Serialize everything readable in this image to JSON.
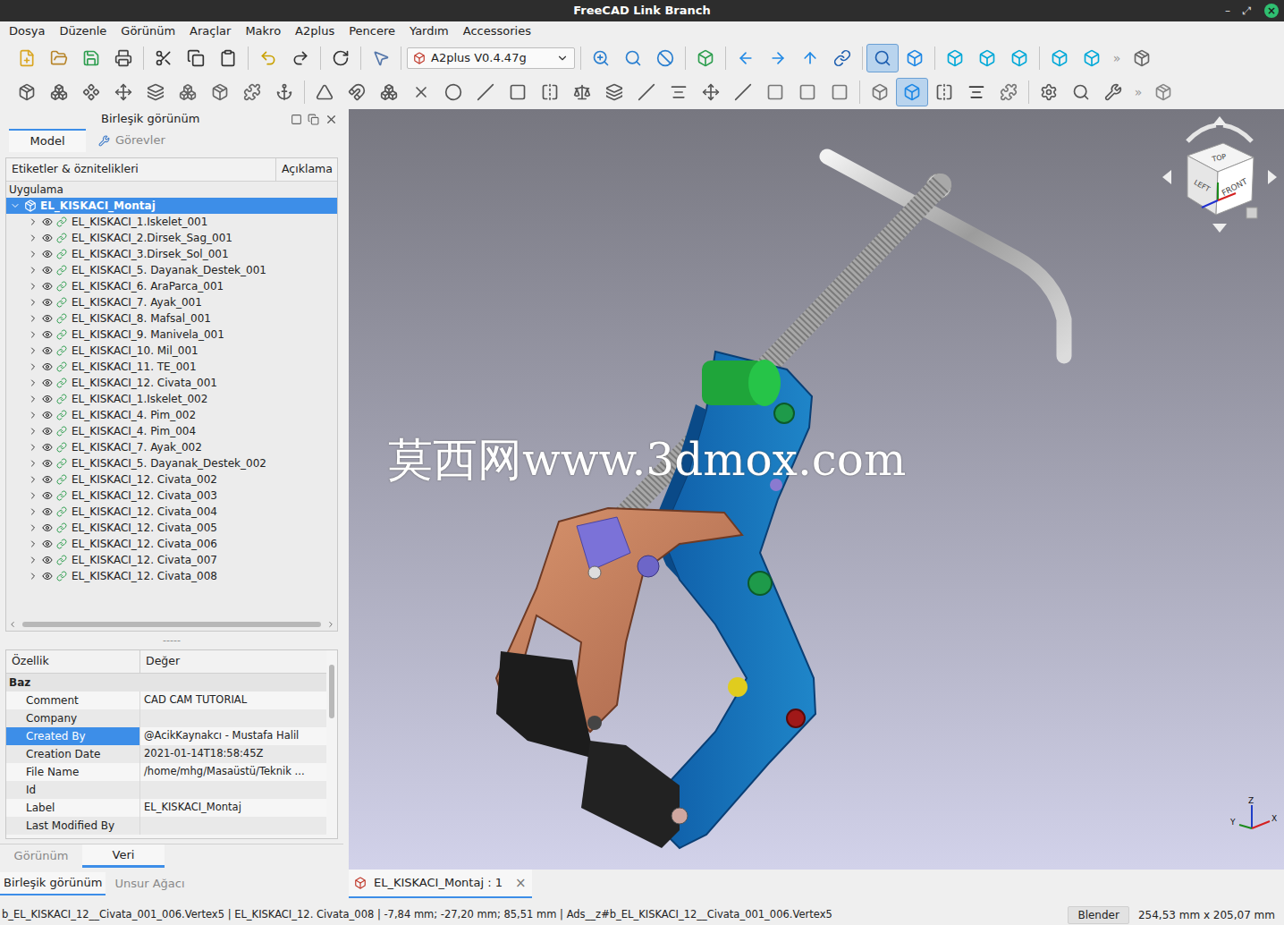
{
  "window": {
    "title": "FreeCAD Link Branch",
    "controls": [
      "–",
      "⤢",
      "×"
    ]
  },
  "menu": [
    "Dosya",
    "Düzenle",
    "Görünüm",
    "Araçlar",
    "Makro",
    "A2plus",
    "Pencere",
    "Yardım",
    "Accessories"
  ],
  "toolbars": {
    "workbench": "A2plus V0.4.47g",
    "overflow": "»",
    "row1": [
      false,
      false,
      false,
      false,
      false,
      false,
      false,
      false,
      false,
      false,
      false,
      false,
      false,
      false,
      false,
      false,
      false,
      false,
      false,
      true,
      false,
      false,
      false,
      false,
      false,
      false,
      false
    ],
    "row2": [
      false,
      false,
      false,
      false,
      false,
      false,
      false,
      false,
      false,
      false,
      false,
      false,
      false,
      false,
      false,
      false,
      false,
      false,
      false,
      false,
      false,
      false,
      false,
      false,
      false,
      false,
      false,
      true,
      false,
      false,
      false,
      false,
      false,
      false,
      false
    ]
  },
  "combo_view": {
    "title": "Birleşik görünüm",
    "tabs": [
      {
        "label": "Model",
        "selected": true
      },
      {
        "label": "Görevler",
        "selected": false
      }
    ]
  },
  "tree": {
    "columns": [
      "Etiketler & öznitelikleri",
      "Açıklama"
    ],
    "group": "Uygulama",
    "root": {
      "label": "EL_KISKACI_Montaj",
      "selected": true,
      "expanded": true
    },
    "items": [
      {
        "label": "EL_KISKACI_1.Iskelet_001",
        "selected": false,
        "expanded": false,
        "visible": true
      },
      {
        "label": "EL_KISKACI_2.Dirsek_Sag_001",
        "selected": false,
        "expanded": false,
        "visible": true
      },
      {
        "label": "EL_KISKACI_3.Dirsek_Sol_001",
        "selected": false,
        "expanded": false,
        "visible": true
      },
      {
        "label": "EL_KISKACI_5. Dayanak_Destek_001",
        "selected": false,
        "expanded": false,
        "visible": true
      },
      {
        "label": "EL_KISKACI_6. AraParca_001",
        "selected": false,
        "expanded": false,
        "visible": true
      },
      {
        "label": "EL_KISKACI_7. Ayak_001",
        "selected": false,
        "expanded": false,
        "visible": true
      },
      {
        "label": "EL_KISKACI_8. Mafsal_001",
        "selected": false,
        "expanded": false,
        "visible": true
      },
      {
        "label": "EL_KISKACI_9. Manivela_001",
        "selected": false,
        "expanded": false,
        "visible": true
      },
      {
        "label": "EL_KISKACI_10. Mil_001",
        "selected": false,
        "expanded": false,
        "visible": true
      },
      {
        "label": "EL_KISKACI_11. TE_001",
        "selected": false,
        "expanded": false,
        "visible": true
      },
      {
        "label": "EL_KISKACI_12. Civata_001",
        "selected": false,
        "expanded": false,
        "visible": true
      },
      {
        "label": "EL_KISKACI_1.Iskelet_002",
        "selected": false,
        "expanded": false,
        "visible": true
      },
      {
        "label": "EL_KISKACI_4. Pim_002",
        "selected": false,
        "expanded": false,
        "visible": true
      },
      {
        "label": "EL_KISKACI_4. Pim_004",
        "selected": false,
        "expanded": false,
        "visible": true
      },
      {
        "label": "EL_KISKACI_7. Ayak_002",
        "selected": false,
        "expanded": false,
        "visible": true
      },
      {
        "label": "EL_KISKACI_5. Dayanak_Destek_002",
        "selected": false,
        "expanded": false,
        "visible": true
      },
      {
        "label": "EL_KISKACI_12. Civata_002",
        "selected": false,
        "expanded": false,
        "visible": true
      },
      {
        "label": "EL_KISKACI_12. Civata_003",
        "selected": false,
        "expanded": false,
        "visible": true
      },
      {
        "label": "EL_KISKACI_12. Civata_004",
        "selected": false,
        "expanded": false,
        "visible": true
      },
      {
        "label": "EL_KISKACI_12. Civata_005",
        "selected": false,
        "expanded": false,
        "visible": true
      },
      {
        "label": "EL_KISKACI_12. Civata_006",
        "selected": false,
        "expanded": false,
        "visible": true
      },
      {
        "label": "EL_KISKACI_12. Civata_007",
        "selected": false,
        "expanded": false,
        "visible": true
      },
      {
        "label": "EL_KISKACI_12. Civata_008",
        "selected": false,
        "expanded": false,
        "visible": true
      }
    ]
  },
  "splitter": "-----",
  "properties": {
    "columns": [
      "Özellik",
      "Değer"
    ],
    "group": "Baz",
    "rows": [
      {
        "name": "Comment",
        "value": "CAD CAM TUTORIAL",
        "selected": false
      },
      {
        "name": "Company",
        "value": "",
        "selected": false
      },
      {
        "name": "Created By",
        "value": "@AcikKaynakcı - Mustafa Halil",
        "selected": true
      },
      {
        "name": "Creation Date",
        "value": "2021-01-14T18:58:45Z",
        "selected": false
      },
      {
        "name": "File Name",
        "value": "/home/mhg/Masaüstü/Teknik ...",
        "selected": false
      },
      {
        "name": "Id",
        "value": "",
        "selected": false
      },
      {
        "name": "Label",
        "value": "EL_KISKACI_Montaj",
        "selected": false
      },
      {
        "name": "Last Modified By",
        "value": "",
        "selected": false
      }
    ]
  },
  "property_tabs": [
    {
      "label": "Görünüm",
      "selected": false
    },
    {
      "label": "Veri",
      "selected": true
    }
  ],
  "panel_tabs": [
    {
      "label": "Birleşik görünüm",
      "selected": true
    },
    {
      "label": "Unsur Ağacı",
      "selected": false
    }
  ],
  "viewport": {
    "watermark": "莫西网www.3dmox.com",
    "nav_cube": {
      "top": "TOP",
      "left": "LEFT",
      "front": "FRONT"
    },
    "axes": [
      "X",
      "Y",
      "Z"
    ]
  },
  "document_tabs": [
    {
      "label": "EL_KISKACI_Montaj : 1",
      "selected": true,
      "close": "×"
    }
  ],
  "status_bar": {
    "message": "b_EL_KISKACI_12__Civata_001_006.Vertex5 | EL_KISKACI_12. Civata_008 | -7,84 mm; -27,20 mm; 85,51 mm | Ads__z#b_EL_KISKACI_12__Civata_001_006.Vertex5",
    "navigation": "Blender",
    "dimensions": "254,53 mm x 205,07 mm"
  }
}
